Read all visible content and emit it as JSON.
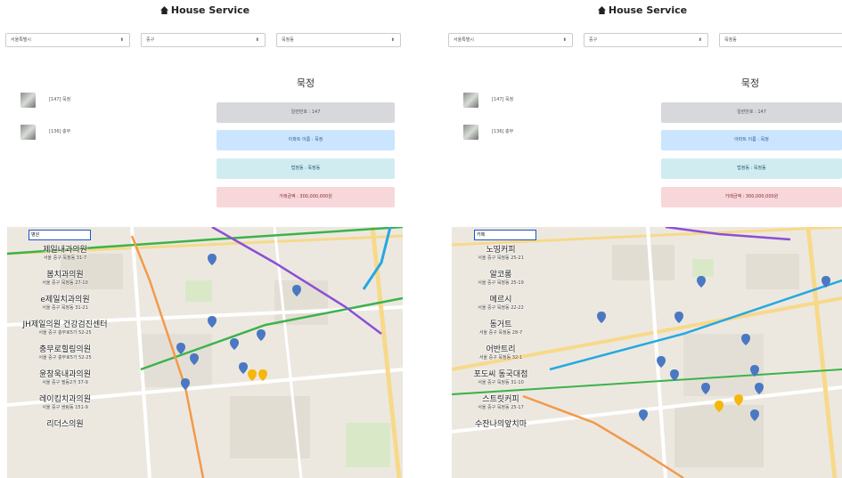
{
  "app_title": "House Service",
  "left": {
    "selects": {
      "city": "서울특별시",
      "district": "중구",
      "dong": "묵정동"
    },
    "detail_title": "묵정",
    "list": [
      {
        "label": "[147] 묵정"
      },
      {
        "label": "[136] 충무"
      }
    ],
    "info": {
      "serial": "일련번호 : 147",
      "apt_name": "아파트 이름 : 묵정",
      "legal_dong": "법정동 : 묵정동",
      "price": "거래금액 : 300,000,000원"
    },
    "map_search": {
      "value": "병원",
      "placeholder": ""
    },
    "places": [
      {
        "name": "제일내과의원",
        "addr": "서울 중구 묵정동 31-7"
      },
      {
        "name": "봄치과의원",
        "addr": "서울 중구 묵정동 27-10"
      },
      {
        "name": "e제일치과의원",
        "addr": "서울 중구 묵정동 31-21"
      },
      {
        "name": "JH제일의원 건강검진센터",
        "addr": "서울 중구 충무로5가 52-25"
      },
      {
        "name": "충무로힐링의원",
        "addr": "서울 중구 충무로5가 52-25"
      },
      {
        "name": "윤창욱내과의원",
        "addr": "서울 중구 필동2가 37-9"
      },
      {
        "name": "레이킴치과의원",
        "addr": "서울 중구 쌍림동 151-9"
      },
      {
        "name": "리더스의원",
        "addr": ""
      }
    ]
  },
  "right": {
    "selects": {
      "city": "서울특별시",
      "district": "중구",
      "dong": "묵정동"
    },
    "detail_title": "묵정",
    "list": [
      {
        "label": "[147] 묵정"
      },
      {
        "label": "[136] 충무"
      }
    ],
    "info": {
      "serial": "일련번호 : 147",
      "apt_name": "아파트 이름 : 묵정",
      "legal_dong": "법정동 : 묵정동",
      "price": "거래금액 : 300,000,000원"
    },
    "map_search": {
      "value": "카페",
      "placeholder": ""
    },
    "places": [
      {
        "name": "노띵커피",
        "addr": "서울 중구 묵정동 25-21"
      },
      {
        "name": "알코롱",
        "addr": "서울 중구 묵정동 25-19"
      },
      {
        "name": "메르시",
        "addr": "서울 중구 묵정동 22-22"
      },
      {
        "name": "동거트",
        "addr": "서울 중구 묵정동 28-7"
      },
      {
        "name": "어반트리",
        "addr": "서울 중구 묵정동 32-1"
      },
      {
        "name": "포도씨 동국대점",
        "addr": "서울 중구 묵정동 31-10"
      },
      {
        "name": "스트릿커피",
        "addr": "서울 중구 묵정동 25-17"
      },
      {
        "name": "수잔나의앞치마",
        "addr": ""
      }
    ]
  },
  "icons": {
    "brand": "house-icon",
    "select_arrow": "updown-arrow-icon",
    "marker": "map-marker-icon"
  },
  "colors": {
    "info_gray": "#d6d8db",
    "info_blue": "#cce5ff",
    "info_teal": "#d1ecf1",
    "info_red": "#f8d7da",
    "search_border": "#1a56c9",
    "marker_blue": "#4a78c2",
    "marker_yellow": "#f5b70b",
    "road_green": "#3bb34a",
    "road_purple": "#8a4fd6",
    "road_orange": "#f29a4a",
    "road_cyan": "#27a8e0"
  }
}
